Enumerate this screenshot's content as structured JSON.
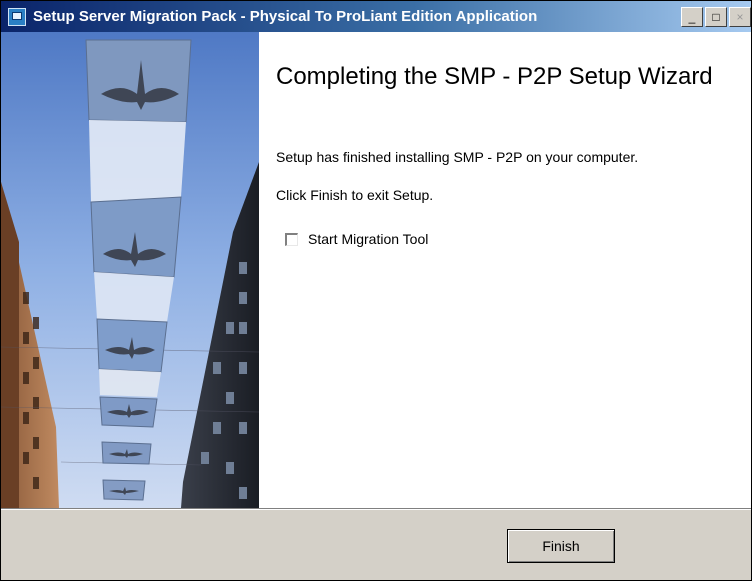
{
  "window": {
    "title": "Setup Server Migration Pack - Physical To ProLiant Edition Application",
    "controls": {
      "minimize": "_",
      "maximize": "□",
      "close": "×"
    }
  },
  "content": {
    "heading": "Completing the SMP - P2P Setup Wizard",
    "line1": "Setup has finished installing SMP - P2P on your computer.",
    "line2": "Click Finish to exit Setup.",
    "checkbox": {
      "label": "Start Migration Tool",
      "checked": false
    }
  },
  "footer": {
    "finish_label": "Finish"
  },
  "colors": {
    "titlebar_start": "#0a246a",
    "titlebar_end": "#a6caf0",
    "dialog_face": "#d4d0c8"
  }
}
